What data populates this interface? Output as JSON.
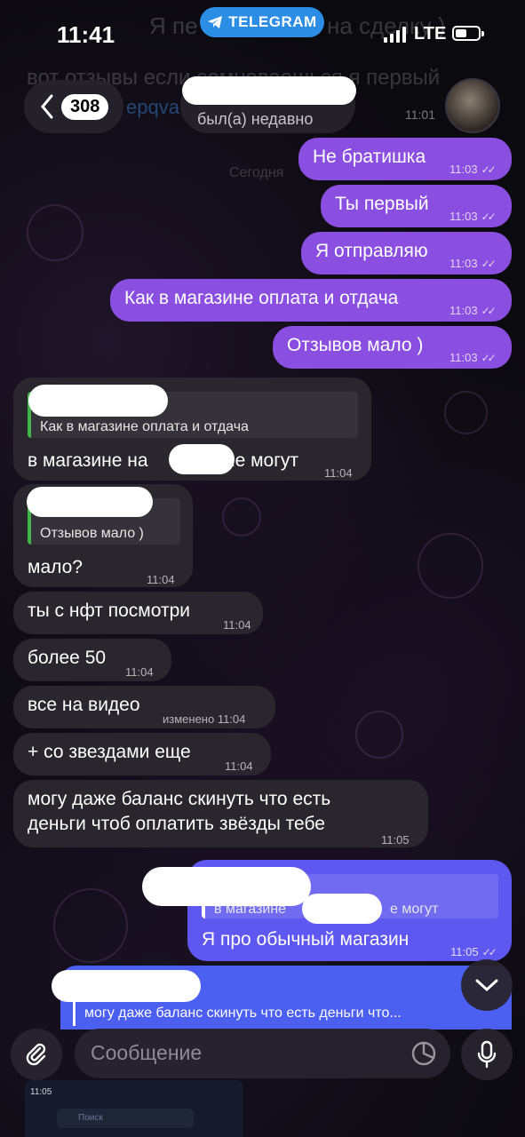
{
  "status": {
    "time": "11:41",
    "network": "LTE",
    "banner": "TELEGRAM"
  },
  "header": {
    "unread_count": "308",
    "last_seen": "был(а) недавно"
  },
  "ghost": {
    "top_text": "Я пе",
    "top_text_right": "на сделку )",
    "line1": "вот отзывы если сомневаешься я первый",
    "date": "Сегодня",
    "time": "11:01",
    "link": "epqva"
  },
  "out_messages": [
    {
      "text": "Не братишка",
      "time": "11:03"
    },
    {
      "text": "Ты первый",
      "time": "11:03"
    },
    {
      "text": "Я отправляю",
      "time": "11:03"
    },
    {
      "text": "Как в магазине оплата и отдача",
      "time": "11:03"
    },
    {
      "text": "Отзывов мало )",
      "time": "11:03"
    }
  ],
  "in_messages": {
    "reply1_quote": "Как в магазине оплата и отдача",
    "reply1_text_a": "в магазине на",
    "reply1_text_b": "не могут",
    "reply1_time": "11:04",
    "reply2_quote": "Отзывов мало )",
    "reply2_text": "мало?",
    "reply2_time": "11:04",
    "m3": {
      "text": "ты с нфт посмотри",
      "time": "11:04"
    },
    "m4": {
      "text": "более 50",
      "time": "11:04"
    },
    "m5": {
      "text": "все на видео",
      "time": "изменено 11:04"
    },
    "m6": {
      "text": "+ со звездами еще",
      "time": "11:04"
    },
    "m7": {
      "line1": "могу даже баланс скинуть что есть",
      "line2": "деньги чтоб оплатить звёзды тебе",
      "time": "11:05"
    }
  },
  "out_reply": {
    "quote_a": "в магазине",
    "quote_b": "е могут",
    "text": "Я про обычный магазин",
    "time": "11:05"
  },
  "draft_reply": {
    "quote": "могу даже баланс скинуть что есть деньги что..."
  },
  "input": {
    "placeholder": "Сообщение"
  },
  "bottom_preview": {
    "time": "11:05",
    "search": "Поиск"
  },
  "icons": {
    "back": "chevron-left-icon",
    "attach": "paperclip-icon",
    "sticker": "sticker-icon",
    "mic": "microphone-icon",
    "scroll": "chevron-down-icon"
  },
  "colors": {
    "outgoing": "#8a4ee0",
    "incoming": "#29262d",
    "telegram": "#2b8de4",
    "reply_accent": "#3fb74a"
  }
}
